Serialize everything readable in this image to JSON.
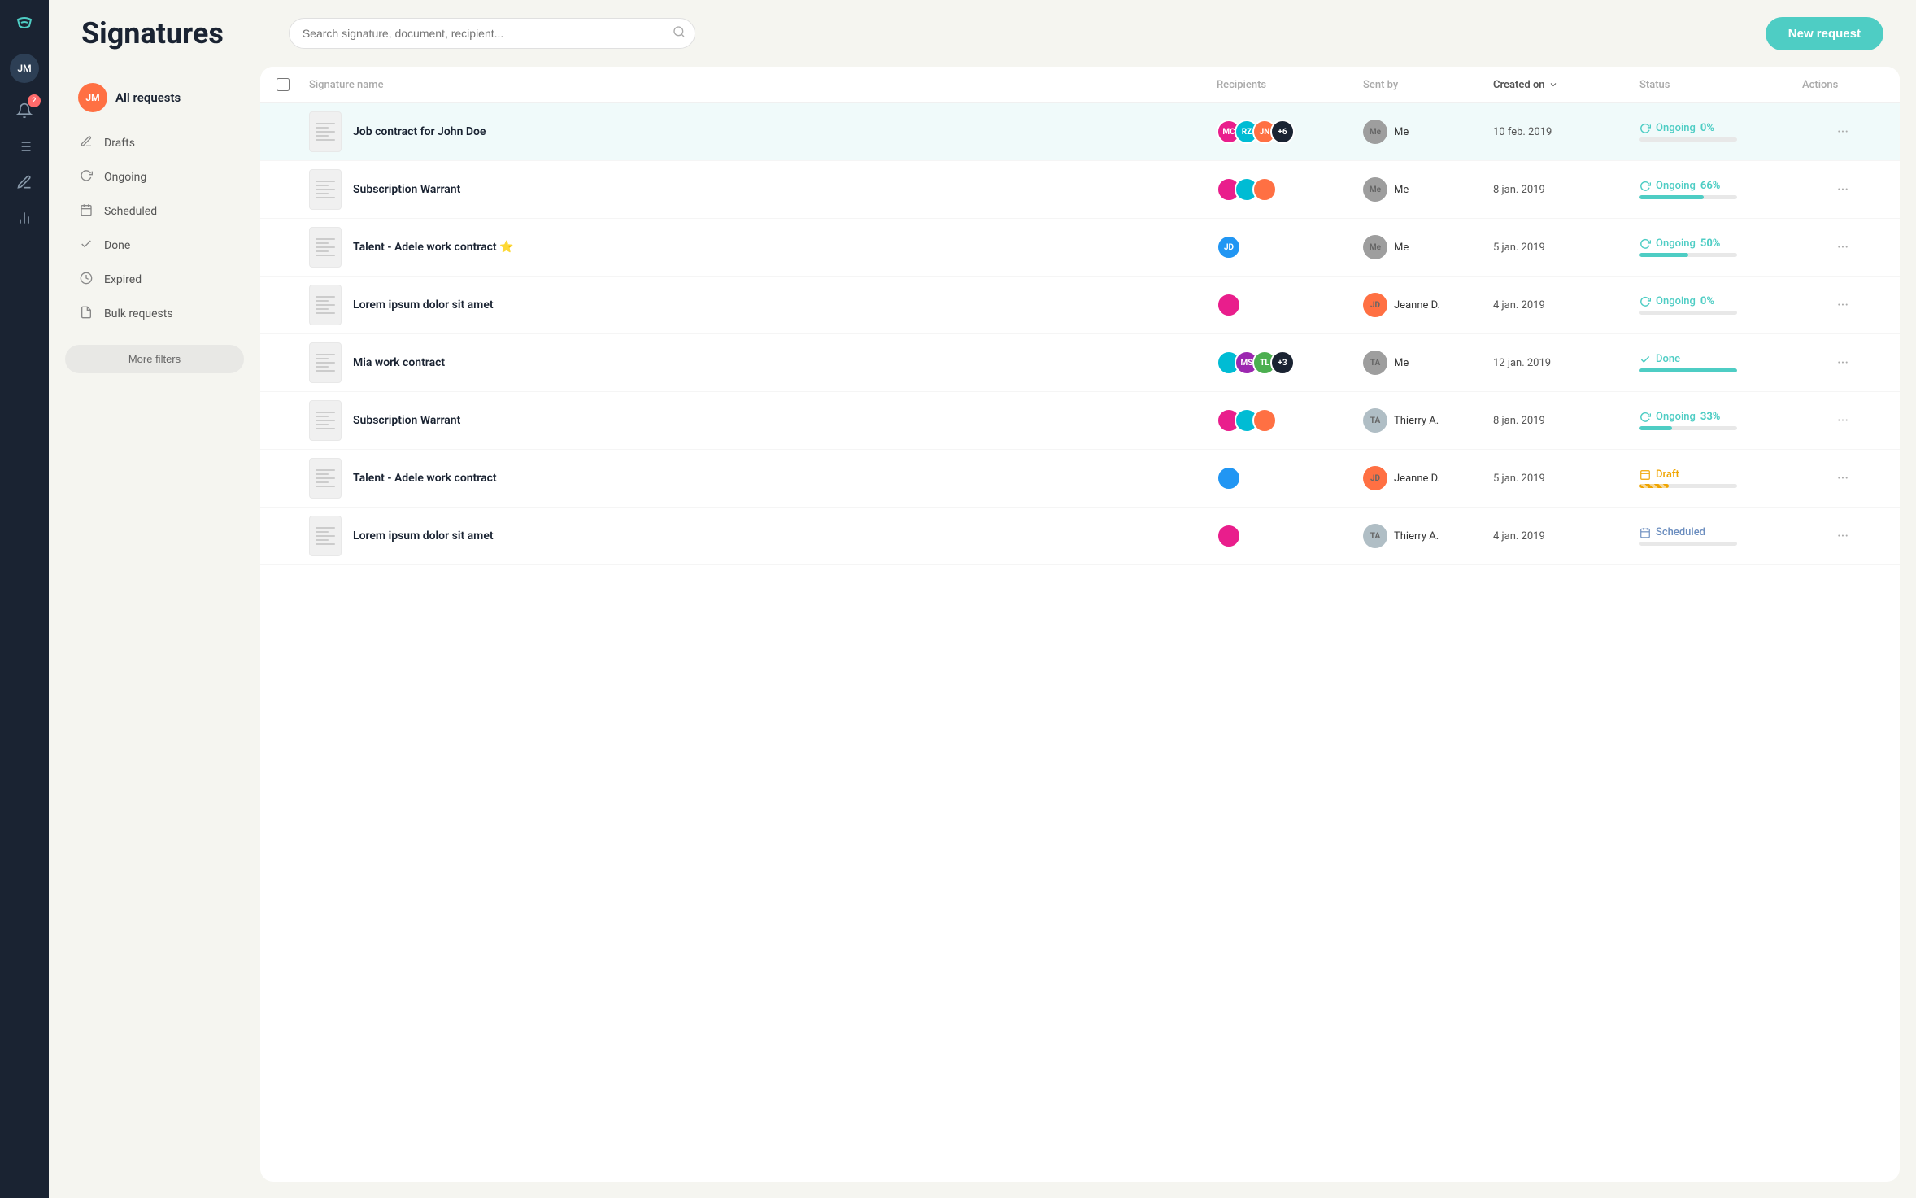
{
  "app": {
    "brand": "S",
    "title": "Signatures"
  },
  "header": {
    "search_placeholder": "Search signature, document, recipient...",
    "new_request_label": "New request"
  },
  "left_nav": {
    "user_initials": "JM",
    "user_label": "All requests",
    "items": [
      {
        "id": "drafts",
        "label": "Drafts",
        "icon": "✏"
      },
      {
        "id": "ongoing",
        "label": "Ongoing",
        "icon": "↻"
      },
      {
        "id": "scheduled",
        "label": "Scheduled",
        "icon": "🗓"
      },
      {
        "id": "done",
        "label": "Done",
        "icon": "✓"
      },
      {
        "id": "expired",
        "label": "Expired",
        "icon": "⏳"
      },
      {
        "id": "bulk",
        "label": "Bulk requests",
        "icon": "📋"
      }
    ],
    "more_filters_label": "More filters"
  },
  "table": {
    "columns": [
      {
        "id": "checkbox",
        "label": ""
      },
      {
        "id": "name",
        "label": "Signature name"
      },
      {
        "id": "recipients",
        "label": "Recipients"
      },
      {
        "id": "sent_by",
        "label": "Sent by"
      },
      {
        "id": "created_on",
        "label": "Created on",
        "sortable": true
      },
      {
        "id": "status",
        "label": "Status"
      },
      {
        "id": "actions",
        "label": "Actions"
      }
    ],
    "rows": [
      {
        "id": 1,
        "name": "Job contract for John Doe",
        "highlighted": true,
        "recipients": [
          {
            "initials": "MC",
            "color": "av-pink"
          },
          {
            "initials": "RZ",
            "color": "av-teal"
          },
          {
            "initials": "JN",
            "color": "av-orange"
          },
          {
            "initials": "+6",
            "color": "av-dark",
            "more": true
          }
        ],
        "sent_by": {
          "initials": "Me",
          "color": "av-gray"
        },
        "sent_by_name": "Me",
        "created_on": "10 feb. 2019",
        "status_type": "ongoing",
        "status_label": "Ongoing",
        "status_pct": "0%",
        "progress": 0
      },
      {
        "id": 2,
        "name": "Subscription Warrant",
        "highlighted": false,
        "recipients": [
          {
            "initials": "",
            "color": "av-pink"
          },
          {
            "initials": "",
            "color": "av-teal"
          },
          {
            "initials": "",
            "color": "av-orange"
          }
        ],
        "sent_by": {
          "initials": "Me",
          "color": "av-gray"
        },
        "sent_by_name": "Me",
        "created_on": "8 jan. 2019",
        "status_type": "ongoing",
        "status_label": "Ongoing",
        "status_pct": "66%",
        "progress": 66
      },
      {
        "id": 3,
        "name": "Talent - Adele work contract ⭐",
        "highlighted": false,
        "recipients": [
          {
            "initials": "JD",
            "color": "av-blue"
          }
        ],
        "sent_by": {
          "initials": "Me",
          "color": "av-gray"
        },
        "sent_by_name": "Me",
        "created_on": "5 jan. 2019",
        "status_type": "ongoing",
        "status_label": "Ongoing",
        "status_pct": "50%",
        "progress": 50
      },
      {
        "id": 4,
        "name": "Lorem ipsum dolor sit amet",
        "highlighted": false,
        "recipients": [
          {
            "initials": "",
            "color": "av-pink"
          }
        ],
        "sent_by": {
          "initials": "JD",
          "color": "av-orange"
        },
        "sent_by_name": "Jeanne D.",
        "created_on": "4 jan. 2019",
        "status_type": "ongoing",
        "status_label": "Ongoing",
        "status_pct": "0%",
        "progress": 0
      },
      {
        "id": 5,
        "name": "Mia work contract",
        "highlighted": false,
        "recipients": [
          {
            "initials": "",
            "color": "av-teal"
          },
          {
            "initials": "MS",
            "color": "av-purple"
          },
          {
            "initials": "TL",
            "color": "av-green"
          },
          {
            "initials": "+3",
            "color": "av-dark",
            "more": true
          }
        ],
        "sent_by": {
          "initials": "TA",
          "color": "av-gray"
        },
        "sent_by_name": "Me",
        "created_on": "12 jan. 2019",
        "status_type": "done",
        "status_label": "Done",
        "status_pct": "",
        "progress": 100
      },
      {
        "id": 6,
        "name": "Subscription Warrant",
        "highlighted": false,
        "recipients": [
          {
            "initials": "",
            "color": "av-pink"
          },
          {
            "initials": "",
            "color": "av-teal"
          },
          {
            "initials": "",
            "color": "av-orange"
          }
        ],
        "sent_by": {
          "initials": "TA",
          "color": "av-light"
        },
        "sent_by_name": "Thierry A.",
        "created_on": "8 jan. 2019",
        "status_type": "ongoing",
        "status_label": "Ongoing",
        "status_pct": "33%",
        "progress": 33
      },
      {
        "id": 7,
        "name": "Talent - Adele work contract",
        "highlighted": false,
        "recipients": [
          {
            "initials": "",
            "color": "av-blue"
          }
        ],
        "sent_by": {
          "initials": "JD",
          "color": "av-orange"
        },
        "sent_by_name": "Jeanne D.",
        "created_on": "5 jan. 2019",
        "status_type": "draft",
        "status_label": "Draft",
        "status_pct": "",
        "progress": 30
      },
      {
        "id": 8,
        "name": "Lorem ipsum dolor sit amet",
        "highlighted": false,
        "recipients": [
          {
            "initials": "",
            "color": "av-pink"
          }
        ],
        "sent_by": {
          "initials": "TA",
          "color": "av-light"
        },
        "sent_by_name": "Thierry A.",
        "created_on": "4 jan. 2019",
        "status_type": "scheduled",
        "status_label": "Scheduled",
        "status_pct": "",
        "progress": 0
      }
    ]
  }
}
